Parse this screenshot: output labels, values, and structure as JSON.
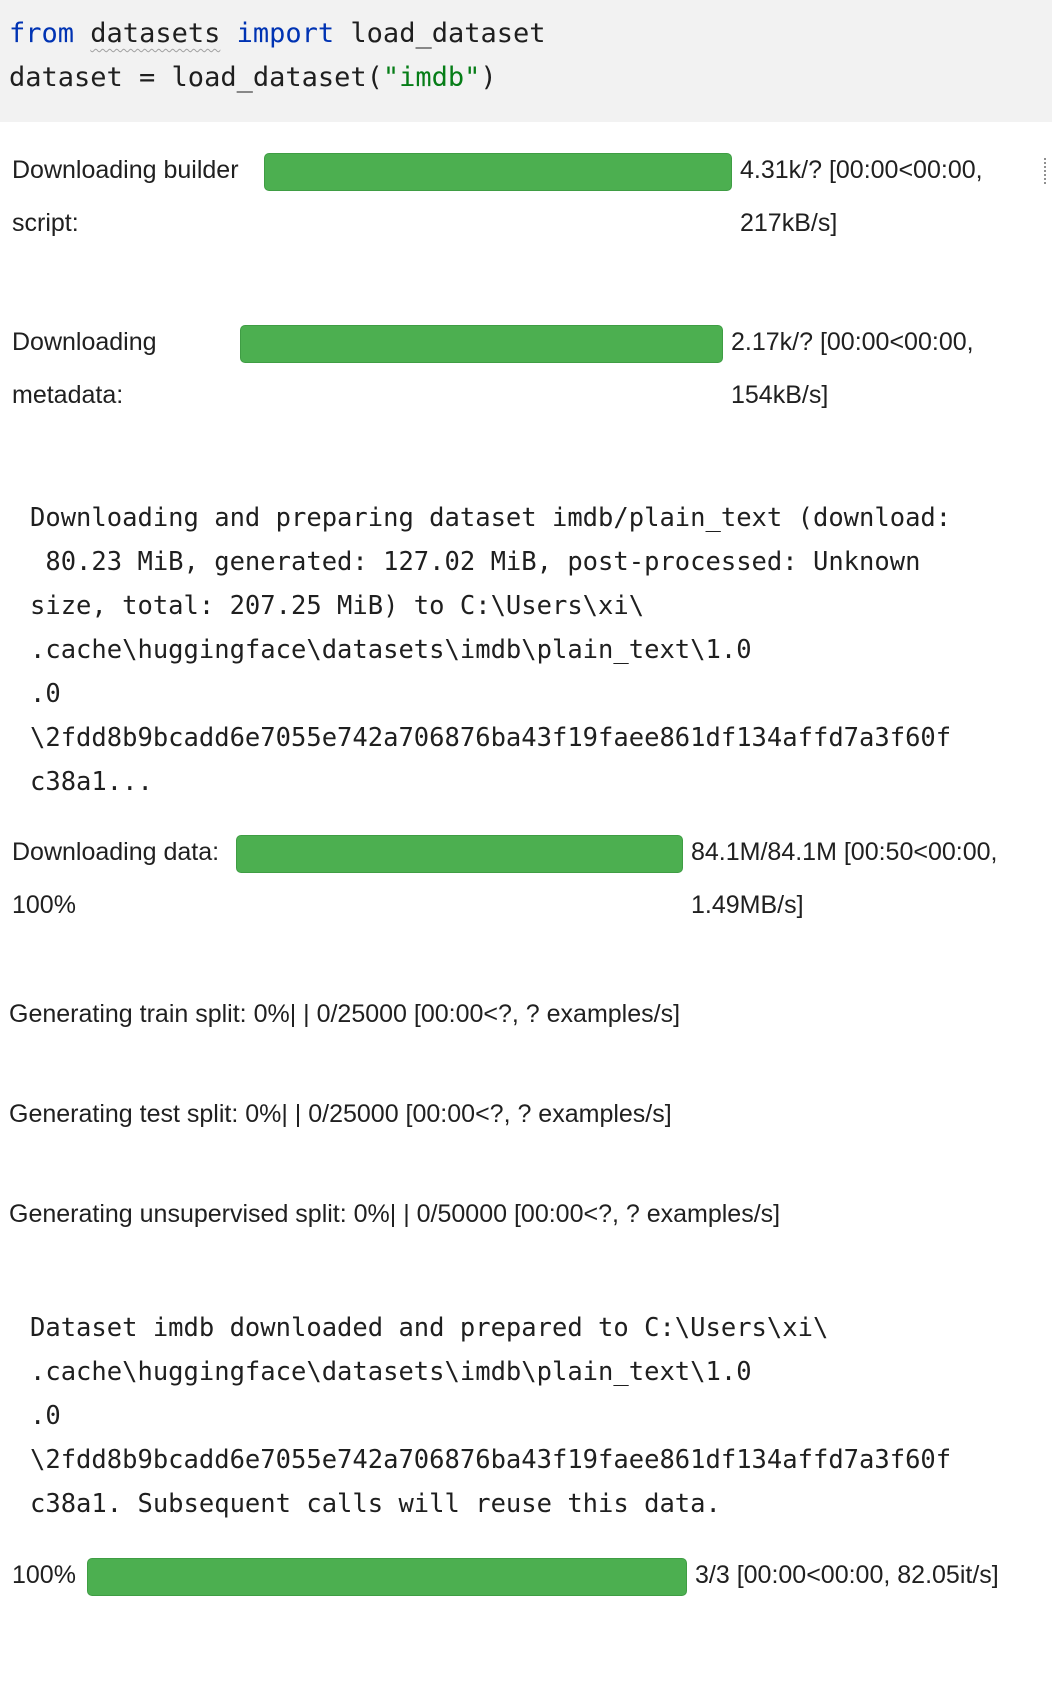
{
  "code": {
    "line1": {
      "kw1": "from",
      "mod": "datasets",
      "kw2": "import",
      "name": "load_dataset"
    },
    "line2": {
      "pre": "dataset = load_dataset(",
      "arg": "\"imdb\"",
      "post": ")"
    }
  },
  "progress": [
    {
      "label1": "Downloading builder",
      "label2": "script:",
      "status1": "4.31k/? [00:00<00:00,",
      "status2": "217kB/s]",
      "fraction": 1.0
    },
    {
      "label1": "Downloading",
      "label2": "metadata:",
      "status1": "2.17k/? [00:00<00:00,",
      "status2": "154kB/s]",
      "fraction": 1.0
    },
    {
      "label1": "Downloading data:",
      "label2": "100%",
      "status1": "84.1M/84.1M [00:50<00:00,",
      "status2": "1.49MB/s]",
      "fraction": 1.0
    },
    {
      "label1": "100%",
      "status1": "3/3 [00:00<00:00, 82.05it/s]",
      "fraction": 1.0
    }
  ],
  "log_prepare": [
    "Downloading and preparing dataset imdb/plain_text (download:",
    " 80.23 MiB, generated: 127.02 MiB, post-processed: Unknown",
    "size, total: 207.25 MiB) to C:\\Users\\xi\\",
    ".cache\\huggingface\\datasets\\imdb\\plain_text\\1.0",
    ".0",
    "\\2fdd8b9bcadd6e7055e742a706876ba43f19faee861df134affd7a3f60f",
    "c38a1..."
  ],
  "splits": [
    "Generating train split: 0%| | 0/25000 [00:00<?, ? examples/s]",
    "Generating test split: 0%| | 0/25000 [00:00<?, ? examples/s]",
    "Generating unsupervised split: 0%| | 0/50000 [00:00<?, ? examples/s]"
  ],
  "log_done": [
    "Dataset imdb downloaded and prepared to C:\\Users\\xi\\",
    ".cache\\huggingface\\datasets\\imdb\\plain_text\\1.0",
    ".0",
    "\\2fdd8b9bcadd6e7055e742a706876ba43f19faee861df134affd7a3f60f",
    "c38a1. Subsequent calls will reuse this data."
  ],
  "colors": {
    "bar": "#4caf50",
    "keyword": "#0033b3",
    "string": "#067d17",
    "cell_bg": "#f2f2f2"
  }
}
